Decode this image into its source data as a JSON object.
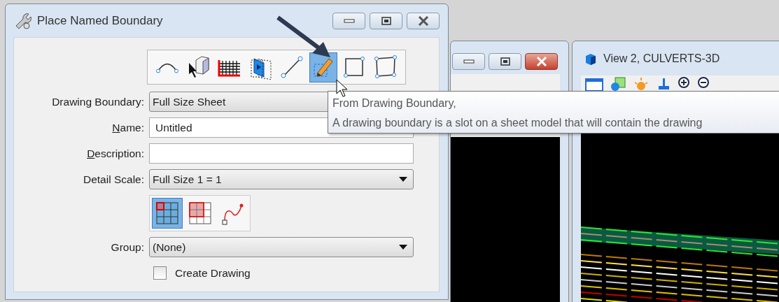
{
  "dialog": {
    "title": "Place Named Boundary",
    "tools": [
      {
        "kind": "arc",
        "selected": false
      },
      {
        "kind": "cube",
        "selected": false
      },
      {
        "kind": "grid",
        "selected": false
      },
      {
        "kind": "layers",
        "selected": false
      },
      {
        "kind": "line",
        "selected": false
      },
      {
        "kind": "pencil",
        "selected": true
      },
      {
        "kind": "square",
        "selected": false
      },
      {
        "kind": "quad",
        "selected": false
      }
    ],
    "fields": [
      {
        "kind": "select",
        "label": "Drawing Boundary:",
        "underline_first": false,
        "value": "Full Size Sheet"
      },
      {
        "kind": "text",
        "label": "Name:",
        "underline_first": true,
        "value": "Untitled"
      },
      {
        "kind": "text",
        "label": "Description:",
        "underline_first": true
      },
      {
        "kind": "select",
        "label": "Detail Scale:",
        "underline_first": false,
        "value": "Full Size 1 = 1"
      }
    ],
    "placement": [
      {
        "kind": "cell",
        "selected": true
      },
      {
        "kind": "block",
        "selected": false
      },
      {
        "kind": "curve",
        "selected": false
      }
    ],
    "group": {
      "label": "Group:",
      "value": "(None)"
    },
    "create_drawing": {
      "label": "Create Drawing",
      "checked": false
    }
  },
  "view_2": {
    "title": "View 2, CULVERTS-3D"
  },
  "tooltip": {
    "lines": [
      "From Drawing Boundary,",
      "A drawing boundary is a slot on a sheet model that will contain the drawing"
    ]
  }
}
